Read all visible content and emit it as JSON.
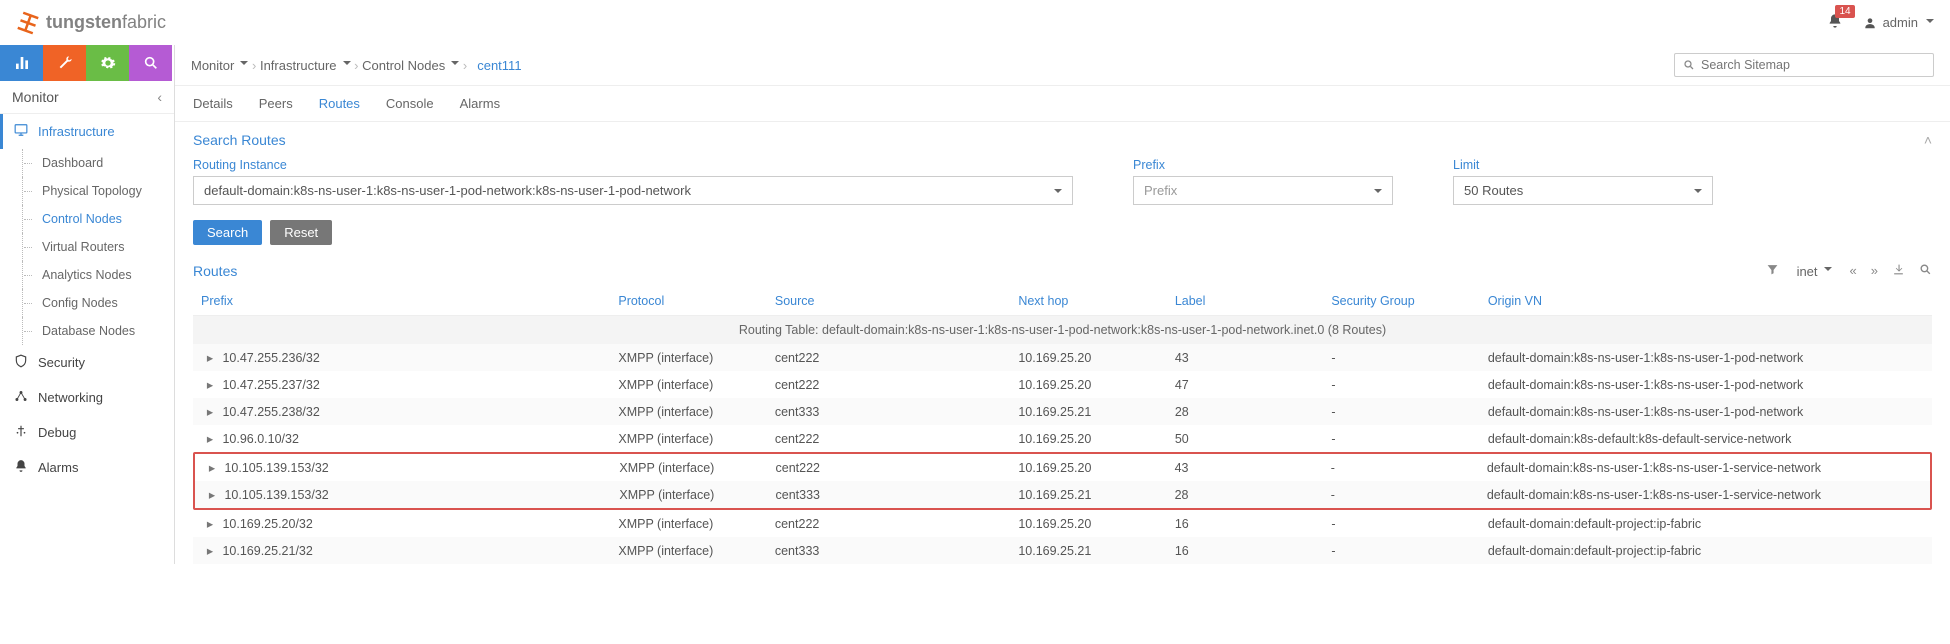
{
  "brand": {
    "name_strong": "tungsten",
    "name_light": "fabric"
  },
  "topright": {
    "notifications": "14",
    "user": "admin"
  },
  "sidebar": {
    "title": "Monitor",
    "groups": [
      {
        "icon": "monitor",
        "label": "Infrastructure",
        "active": true,
        "children": [
          {
            "label": "Dashboard"
          },
          {
            "label": "Physical Topology"
          },
          {
            "label": "Control Nodes",
            "active": true
          },
          {
            "label": "Virtual Routers"
          },
          {
            "label": "Analytics Nodes"
          },
          {
            "label": "Config Nodes"
          },
          {
            "label": "Database Nodes"
          }
        ]
      },
      {
        "icon": "shield",
        "label": "Security"
      },
      {
        "icon": "network",
        "label": "Networking"
      },
      {
        "icon": "debug",
        "label": "Debug"
      },
      {
        "icon": "bell",
        "label": "Alarms"
      }
    ]
  },
  "breadcrumb": {
    "items": [
      "Monitor",
      "Infrastructure",
      "Control Nodes"
    ],
    "current": "cent111"
  },
  "search_sitemap_placeholder": "Search Sitemap",
  "tabs": [
    "Details",
    "Peers",
    "Routes",
    "Console",
    "Alarms"
  ],
  "active_tab": "Routes",
  "search_section": "Search Routes",
  "filters": {
    "routing_instance": {
      "label": "Routing Instance",
      "value": "default-domain:k8s-ns-user-1:k8s-ns-user-1-pod-network:k8s-ns-user-1-pod-network"
    },
    "prefix": {
      "label": "Prefix",
      "placeholder": "Prefix"
    },
    "limit": {
      "label": "Limit",
      "value": "50 Routes"
    }
  },
  "buttons": {
    "search": "Search",
    "reset": "Reset"
  },
  "routes_title": "Routes",
  "table_type": "inet",
  "columns": [
    "Prefix",
    "Protocol",
    "Source",
    "Next hop",
    "Label",
    "Security Group",
    "Origin VN"
  ],
  "group_row": {
    "prefix_text": "Routing Table: default-domain:k8s-ns-user-1:k8s-ns-user-1-pod-network:k8s-ns-user-1-pod-network.inet.0 ",
    "count": "(8 Routes)"
  },
  "rows": [
    {
      "prefix": "10.47.255.236/32",
      "protocol": "XMPP (interface)",
      "source": "cent222",
      "nexthop": "10.169.25.20",
      "label": "43",
      "sg": "-",
      "origin": "default-domain:k8s-ns-user-1:k8s-ns-user-1-pod-network"
    },
    {
      "prefix": "10.47.255.237/32",
      "protocol": "XMPP (interface)",
      "source": "cent222",
      "nexthop": "10.169.25.20",
      "label": "47",
      "sg": "-",
      "origin": "default-domain:k8s-ns-user-1:k8s-ns-user-1-pod-network"
    },
    {
      "prefix": "10.47.255.238/32",
      "protocol": "XMPP (interface)",
      "source": "cent333",
      "nexthop": "10.169.25.21",
      "label": "28",
      "sg": "-",
      "origin": "default-domain:k8s-ns-user-1:k8s-ns-user-1-pod-network"
    },
    {
      "prefix": "10.96.0.10/32",
      "protocol": "XMPP (interface)",
      "source": "cent222",
      "nexthop": "10.169.25.20",
      "label": "50",
      "sg": "-",
      "origin": "default-domain:k8s-default:k8s-default-service-network"
    }
  ],
  "highlight_rows": [
    {
      "prefix": "10.105.139.153/32",
      "protocol": "XMPP (interface)",
      "source": "cent222",
      "nexthop": "10.169.25.20",
      "label": "43",
      "sg": "-",
      "origin": "default-domain:k8s-ns-user-1:k8s-ns-user-1-service-network"
    },
    {
      "prefix": "10.105.139.153/32",
      "protocol": "XMPP (interface)",
      "source": "cent333",
      "nexthop": "10.169.25.21",
      "label": "28",
      "sg": "-",
      "origin": "default-domain:k8s-ns-user-1:k8s-ns-user-1-service-network"
    }
  ],
  "rows_after": [
    {
      "prefix": "10.169.25.20/32",
      "protocol": "XMPP (interface)",
      "source": "cent222",
      "nexthop": "10.169.25.20",
      "label": "16",
      "sg": "-",
      "origin": "default-domain:default-project:ip-fabric"
    },
    {
      "prefix": "10.169.25.21/32",
      "protocol": "XMPP (interface)",
      "source": "cent333",
      "nexthop": "10.169.25.21",
      "label": "16",
      "sg": "-",
      "origin": "default-domain:default-project:ip-fabric"
    }
  ]
}
